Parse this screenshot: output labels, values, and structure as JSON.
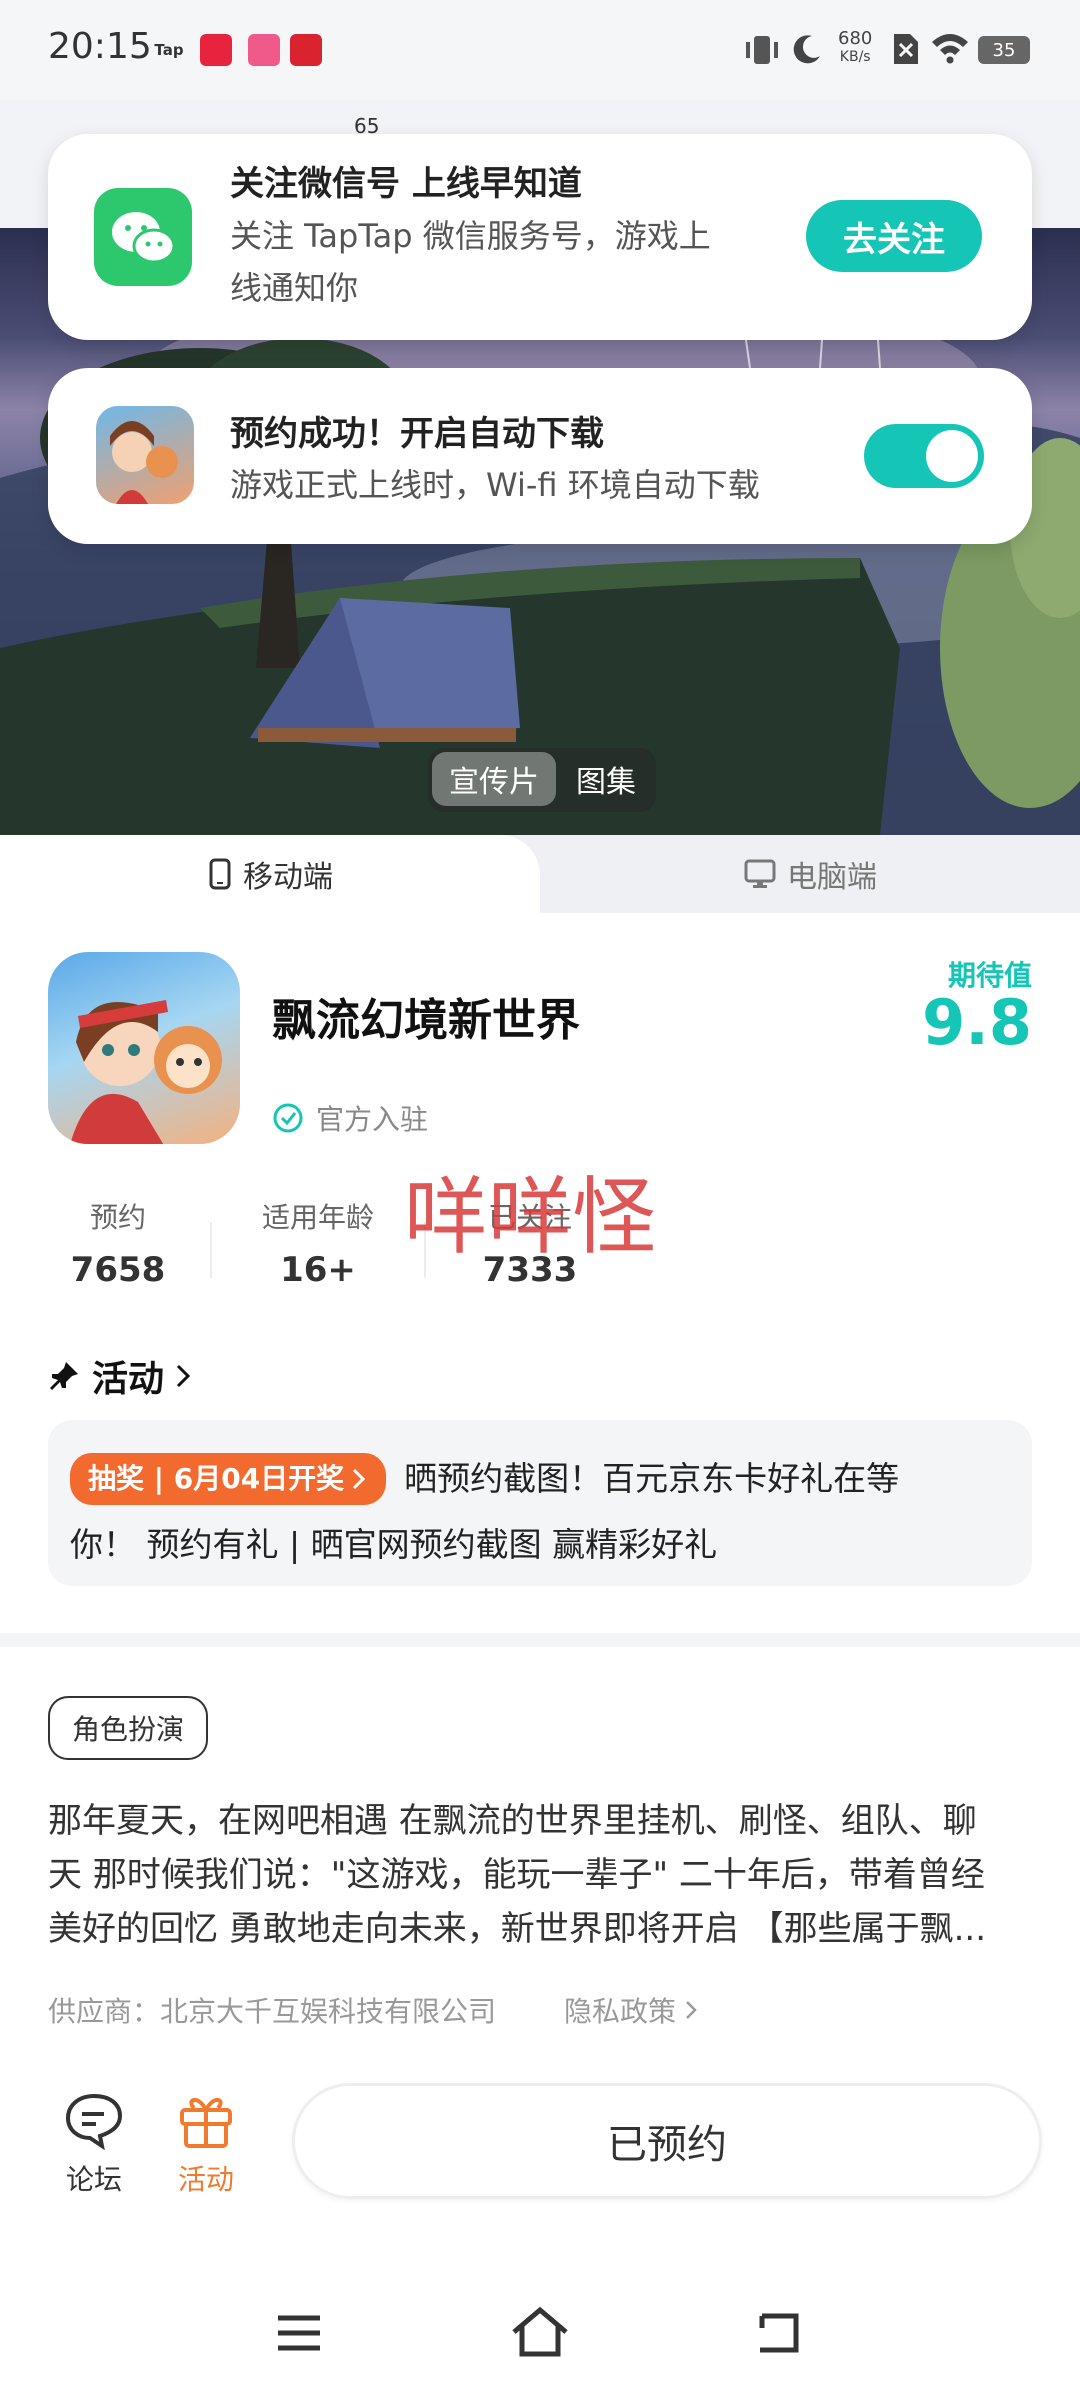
{
  "status_bar": {
    "time": "20:15",
    "app_icons": [
      "Tap",
      "小红书",
      "Lolita",
      "抖音"
    ],
    "net_speed": "680",
    "net_unit": "KB/s",
    "battery": "35"
  },
  "behind_text": "65",
  "wechat_card": {
    "title": "关注微信号 上线早知道",
    "desc_line1": "关注 TapTap 微信服务号，游戏上",
    "desc_line2": "线通知你",
    "button": "去关注"
  },
  "autodl_card": {
    "title": "预约成功！开启自动下载",
    "desc": "游戏正式上线时，Wi-fi 环境自动下载",
    "toggle_on": true
  },
  "media_tabs": [
    "宣传片",
    "图集"
  ],
  "platform_tabs": {
    "mobile": "移动端",
    "pc": "电脑端"
  },
  "game": {
    "name": "飘流幻境新世界",
    "verified": "官方入驻",
    "expect_label": "期待值",
    "expect_score": "9.8"
  },
  "stats": [
    {
      "label": "预约",
      "value": "7658"
    },
    {
      "label": "适用年龄",
      "value": "16+"
    },
    {
      "label": "已关注",
      "value": "7333"
    }
  ],
  "watermark": "咩咩怪",
  "activity": {
    "heading": "活动",
    "badge": "抽奖 | 6月04日开奖",
    "text_line1": "晒预约截图！百元京东卡好礼在等",
    "text_line2": "你！ 预约有礼 | 晒官网预约截图 赢精彩好礼"
  },
  "genre_tag": "角色扮演",
  "description": {
    "line1": "那年夏天，在网吧相遇 在飘流的世界里挂机、刷怪、组队、聊",
    "line2": "天 那时候我们说：\"这游戏，能玩一辈子\" 二十年后，带着曾经",
    "line3": "美好的回忆 勇敢地走向未来，新世界即将开启 【那些属于飘..."
  },
  "supplier": "供应商：北京大千互娱科技有限公司",
  "privacy": "隐私政策",
  "bottom": {
    "forum": "论坛",
    "activity": "活动",
    "reserved": "已预约"
  },
  "colors": {
    "accent": "#15c5b5",
    "orange": "#f26a2e",
    "wechat_green": "#2dc86d"
  }
}
